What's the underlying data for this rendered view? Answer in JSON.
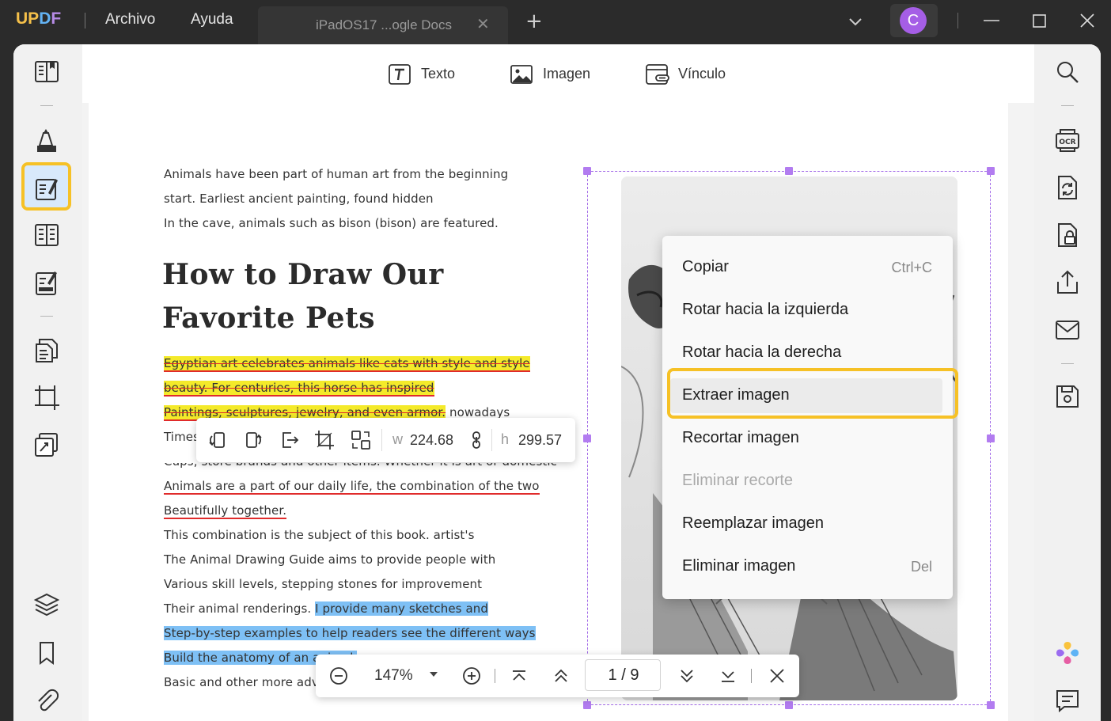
{
  "titlebar": {
    "logo": {
      "u": "U",
      "p": "P",
      "d": "D",
      "f": "F"
    },
    "menu": {
      "file": "Archivo",
      "help": "Ayuda"
    },
    "tab_title": "iPadOS17 ...ogle Docs",
    "tab_close": "✕",
    "tab_add": "+",
    "avatar_initial": "C"
  },
  "toolbar": {
    "text_label": "Texto",
    "image_label": "Imagen",
    "link_label": "Vínculo"
  },
  "document": {
    "intro": [
      "Animals have been part of human art from the beginning",
      "start. Earliest ancient painting, found hidden",
      "In the cave, animals such as bison (bison) are featured."
    ],
    "heading_line1": "How to Draw Our",
    "heading_line2": "Favorite Pets",
    "yellow_lines": [
      "Egyptian art celebrates animals like cats with style and style",
      "beauty. For centuries, this horse has inspired",
      "Paintings, sculptures, jewelry, and even armor."
    ],
    "yellow_tail": " nowadays",
    "times_fragment": "Times",
    "cups_line": "Cups, store brands and other items. Whether it is art or domestic",
    "red_lines": [
      "Animals are a part of our daily life, the combination of the two",
      "Beautifully together."
    ],
    "plain_lines": [
      "This combination is the subject of this book. artist's",
      "The Animal Drawing Guide aims to provide people with",
      "Various skill levels, stepping stones for improvement"
    ],
    "renderings_prefix": "Their animal renderings. ",
    "blue_lines": [
      "I provide many sketches and",
      "Step-by-step examples to help readers see the different ways",
      "Build the anatomy of an animal."
    ],
    "last_line": "Basic and other more adv"
  },
  "image_toolbar": {
    "w_label": "w",
    "w_value": "224.68",
    "h_label": "h",
    "h_value": "299.57"
  },
  "context_menu": {
    "items": [
      {
        "label": "Copiar",
        "shortcut": "Ctrl+C"
      },
      {
        "label": "Rotar hacia la izquierda",
        "shortcut": ""
      },
      {
        "label": "Rotar hacia la derecha",
        "shortcut": ""
      },
      {
        "label": "Extraer imagen",
        "shortcut": ""
      },
      {
        "label": "Recortar imagen",
        "shortcut": ""
      },
      {
        "label": "Eliminar recorte",
        "shortcut": ""
      },
      {
        "label": "Reemplazar imagen",
        "shortcut": ""
      },
      {
        "label": "Eliminar imagen",
        "shortcut": "Del"
      }
    ]
  },
  "navbar": {
    "zoom": "147%",
    "page_indicator": "1 / 9"
  },
  "colors": {
    "accent_purple": "#a55ee6",
    "highlight_yellow": "#f4ea2a",
    "highlight_blue": "#7ec0f5",
    "underline_red": "#e02b2b",
    "focus_outline": "#f6c126"
  },
  "icons": {
    "left_rail": [
      "reader-icon",
      "comment-icon",
      "edit-pdf-icon",
      "page-layout-icon",
      "form-icon",
      "organize-pages-icon",
      "crop-icon",
      "protect-icon",
      "layers-icon",
      "bookmark-icon",
      "attachment-icon"
    ],
    "right_rail": [
      "search-icon",
      "ocr-icon",
      "convert-icon",
      "protect-doc-icon",
      "share-icon",
      "email-icon",
      "save-icon",
      "ai-assistant-icon",
      "chat-icon"
    ]
  }
}
